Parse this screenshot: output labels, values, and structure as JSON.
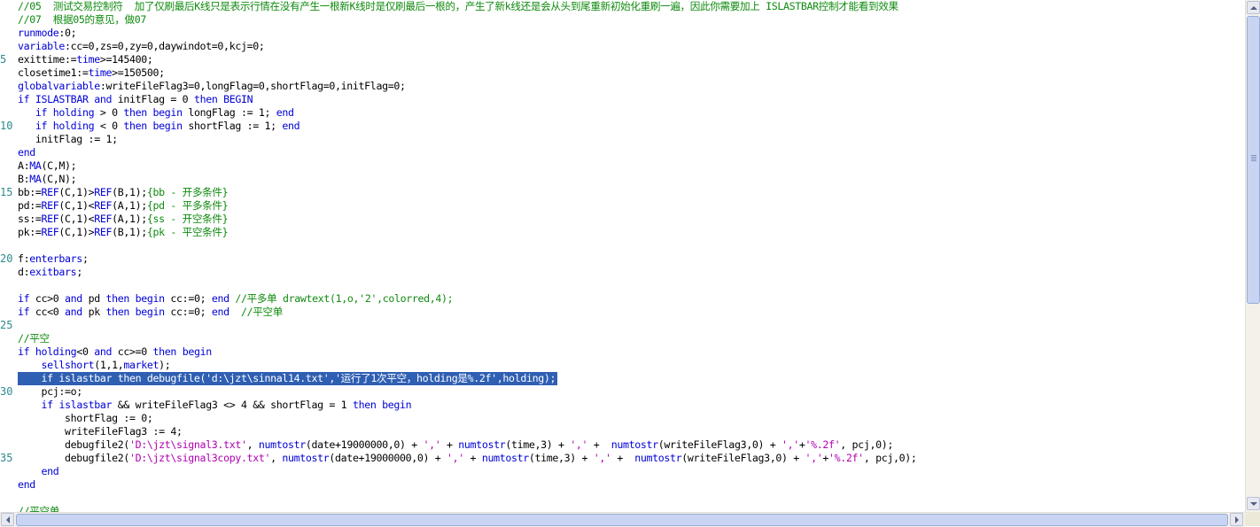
{
  "editor": {
    "line_numbers": [
      "5",
      "10",
      "15",
      "20",
      "25",
      "30",
      "35"
    ],
    "lines": [
      [
        [
          "cm",
          "//05  测试交易控制符  加了仅刷最后K线只是表示行情在没有产生一根新K线时是仅刷最后一根的，产生了新k线还是会从头到尾重新初始化重刷一遍，因此你需要加上 ISLASTBAR控制才能看到效果"
        ]
      ],
      [
        [
          "cm",
          "//07  根据05的意见，做07"
        ]
      ],
      [
        [
          "kw",
          "runmode"
        ],
        [
          "pl",
          ":0;"
        ]
      ],
      [
        [
          "kw",
          "variable"
        ],
        [
          "pl",
          ":cc=0,zs=0,zy=0,daywindot=0,kcj=0;"
        ]
      ],
      [
        [
          "pl",
          "exittime:="
        ],
        [
          "kw",
          "time"
        ],
        [
          "pl",
          ">=145400;"
        ]
      ],
      [
        [
          "pl",
          "closetime1:="
        ],
        [
          "kw",
          "time"
        ],
        [
          "pl",
          ">=150500;"
        ]
      ],
      [
        [
          "kw",
          "globalvariable"
        ],
        [
          "pl",
          ":writeFileFlag3=0,longFlag=0,shortFlag=0,initFlag=0;"
        ]
      ],
      [
        [
          "kw",
          "if"
        ],
        [
          "pl",
          " "
        ],
        [
          "kw",
          "ISLASTBAR"
        ],
        [
          "pl",
          " "
        ],
        [
          "kw",
          "and"
        ],
        [
          "pl",
          " initFlag = 0 "
        ],
        [
          "kw",
          "then"
        ],
        [
          "pl",
          " "
        ],
        [
          "kw",
          "BEGIN"
        ]
      ],
      [
        [
          "pl",
          "   "
        ],
        [
          "kw",
          "if"
        ],
        [
          "pl",
          " "
        ],
        [
          "kw",
          "holding"
        ],
        [
          "pl",
          " > 0 "
        ],
        [
          "kw",
          "then"
        ],
        [
          "pl",
          " "
        ],
        [
          "kw",
          "begin"
        ],
        [
          "pl",
          " longFlag := 1; "
        ],
        [
          "kw",
          "end"
        ]
      ],
      [
        [
          "pl",
          "   "
        ],
        [
          "kw",
          "if"
        ],
        [
          "pl",
          " "
        ],
        [
          "kw",
          "holding"
        ],
        [
          "pl",
          " < 0 "
        ],
        [
          "kw",
          "then"
        ],
        [
          "pl",
          " "
        ],
        [
          "kw",
          "begin"
        ],
        [
          "pl",
          " shortFlag := 1; "
        ],
        [
          "kw",
          "end"
        ]
      ],
      [
        [
          "pl",
          "   initFlag := 1;"
        ]
      ],
      [
        [
          "kw",
          "end"
        ]
      ],
      [
        [
          "pl",
          "A:"
        ],
        [
          "kw",
          "MA"
        ],
        [
          "pl",
          "(C,M);"
        ]
      ],
      [
        [
          "pl",
          "B:"
        ],
        [
          "kw",
          "MA"
        ],
        [
          "pl",
          "(C,N);"
        ]
      ],
      [
        [
          "pl",
          "bb:="
        ],
        [
          "kw",
          "REF"
        ],
        [
          "pl",
          "(C,1)>"
        ],
        [
          "kw",
          "REF"
        ],
        [
          "pl",
          "(B,1);"
        ],
        [
          "cm",
          "{bb - 开多条件}"
        ]
      ],
      [
        [
          "pl",
          "pd:="
        ],
        [
          "kw",
          "REF"
        ],
        [
          "pl",
          "(C,1)<"
        ],
        [
          "kw",
          "REF"
        ],
        [
          "pl",
          "(A,1);"
        ],
        [
          "cm",
          "{pd - 平多条件}"
        ]
      ],
      [
        [
          "pl",
          "ss:="
        ],
        [
          "kw",
          "REF"
        ],
        [
          "pl",
          "(C,1)<"
        ],
        [
          "kw",
          "REF"
        ],
        [
          "pl",
          "(A,1);"
        ],
        [
          "cm",
          "{ss - 开空条件}"
        ]
      ],
      [
        [
          "pl",
          "pk:="
        ],
        [
          "kw",
          "REF"
        ],
        [
          "pl",
          "(C,1)>"
        ],
        [
          "kw",
          "REF"
        ],
        [
          "pl",
          "(B,1);"
        ],
        [
          "cm",
          "{pk - 平空条件}"
        ]
      ],
      [],
      [
        [
          "pl",
          "f:"
        ],
        [
          "kw",
          "enterbars"
        ],
        [
          "pl",
          ";"
        ]
      ],
      [
        [
          "pl",
          "d:"
        ],
        [
          "kw",
          "exitbars"
        ],
        [
          "pl",
          ";"
        ]
      ],
      [],
      [
        [
          "kw",
          "if"
        ],
        [
          "pl",
          " cc>0 "
        ],
        [
          "kw",
          "and"
        ],
        [
          "pl",
          " pd "
        ],
        [
          "kw",
          "then"
        ],
        [
          "pl",
          " "
        ],
        [
          "kw",
          "begin"
        ],
        [
          "pl",
          " cc:=0; "
        ],
        [
          "kw",
          "end"
        ],
        [
          "pl",
          " "
        ],
        [
          "cm",
          "//平多单 drawtext(1,o,'2',colorred,4);"
        ]
      ],
      [
        [
          "kw",
          "if"
        ],
        [
          "pl",
          " cc<0 "
        ],
        [
          "kw",
          "and"
        ],
        [
          "pl",
          " pk "
        ],
        [
          "kw",
          "then"
        ],
        [
          "pl",
          " "
        ],
        [
          "kw",
          "begin"
        ],
        [
          "pl",
          " cc:=0; "
        ],
        [
          "kw",
          "end"
        ],
        [
          "pl",
          "  "
        ],
        [
          "cm",
          "//平空单"
        ]
      ],
      [],
      [
        [
          "cm",
          "//平空"
        ]
      ],
      [
        [
          "kw",
          "if"
        ],
        [
          "pl",
          " "
        ],
        [
          "kw",
          "holding"
        ],
        [
          "pl",
          "<0 "
        ],
        [
          "kw",
          "and"
        ],
        [
          "pl",
          " cc>=0 "
        ],
        [
          "kw",
          "then"
        ],
        [
          "pl",
          " "
        ],
        [
          "kw",
          "begin"
        ]
      ],
      [
        [
          "pl",
          "    "
        ],
        [
          "kw",
          "sellshort"
        ],
        [
          "pl",
          "(1,1,"
        ],
        [
          "kw",
          "market"
        ],
        [
          "pl",
          ");"
        ]
      ],
      [
        [
          "pl",
          "    if islastbar then debugfile('d:\\jzt\\sinnal14.txt','运行了1次平空，holding是%.2f',holding);"
        ]
      ],
      [
        [
          "pl",
          "    pcj:=o;"
        ]
      ],
      [
        [
          "pl",
          "    "
        ],
        [
          "kw",
          "if"
        ],
        [
          "pl",
          " "
        ],
        [
          "kw",
          "islastbar"
        ],
        [
          "pl",
          " && writeFileFlag3 <> 4 && shortFlag = 1 "
        ],
        [
          "kw",
          "then"
        ],
        [
          "pl",
          " "
        ],
        [
          "kw",
          "begin"
        ]
      ],
      [
        [
          "pl",
          "        shortFlag := 0;"
        ]
      ],
      [
        [
          "pl",
          "        writeFileFlag3 := 4;"
        ]
      ],
      [
        [
          "pl",
          "        debugfile2("
        ],
        [
          "st",
          "'D:\\jzt\\signal3.txt'"
        ],
        [
          "pl",
          ", "
        ],
        [
          "kw",
          "numtostr"
        ],
        [
          "pl",
          "(date+19000000,0) + "
        ],
        [
          "st",
          "','"
        ],
        [
          "pl",
          " + "
        ],
        [
          "kw",
          "numtostr"
        ],
        [
          "pl",
          "(time,3) + "
        ],
        [
          "st",
          "','"
        ],
        [
          "pl",
          " +  "
        ],
        [
          "kw",
          "numtostr"
        ],
        [
          "pl",
          "(writeFileFlag3,0) + "
        ],
        [
          "st",
          "','"
        ],
        [
          "pl",
          "+"
        ],
        [
          "st",
          "'%.2f'"
        ],
        [
          "pl",
          ", pcj,0);"
        ]
      ],
      [
        [
          "pl",
          "        debugfile2("
        ],
        [
          "st",
          "'D:\\jzt\\signal3copy.txt'"
        ],
        [
          "pl",
          ", "
        ],
        [
          "kw",
          "numtostr"
        ],
        [
          "pl",
          "(date+19000000,0) + "
        ],
        [
          "st",
          "','"
        ],
        [
          "pl",
          " + "
        ],
        [
          "kw",
          "numtostr"
        ],
        [
          "pl",
          "(time,3) + "
        ],
        [
          "st",
          "','"
        ],
        [
          "pl",
          " +  "
        ],
        [
          "kw",
          "numtostr"
        ],
        [
          "pl",
          "(writeFileFlag3,0) + "
        ],
        [
          "st",
          "','"
        ],
        [
          "pl",
          "+"
        ],
        [
          "st",
          "'%.2f'"
        ],
        [
          "pl",
          ", pcj,0);"
        ]
      ],
      [
        [
          "pl",
          "    "
        ],
        [
          "kw",
          "end"
        ]
      ],
      [
        [
          "kw",
          "end"
        ]
      ],
      [],
      [
        [
          "cm",
          "//平空单"
        ]
      ]
    ]
  },
  "colors": {
    "comment": "#0f8a0f",
    "keyword": "#0000d8",
    "string": "#b000b0",
    "selection": "#2f5fb3",
    "line_number": "#2d8a8e"
  },
  "icons": {
    "scroll_up": "triangle-up-icon",
    "scroll_down": "triangle-down-icon",
    "scroll_left": "triangle-left-icon",
    "scroll_right": "triangle-right-icon"
  }
}
